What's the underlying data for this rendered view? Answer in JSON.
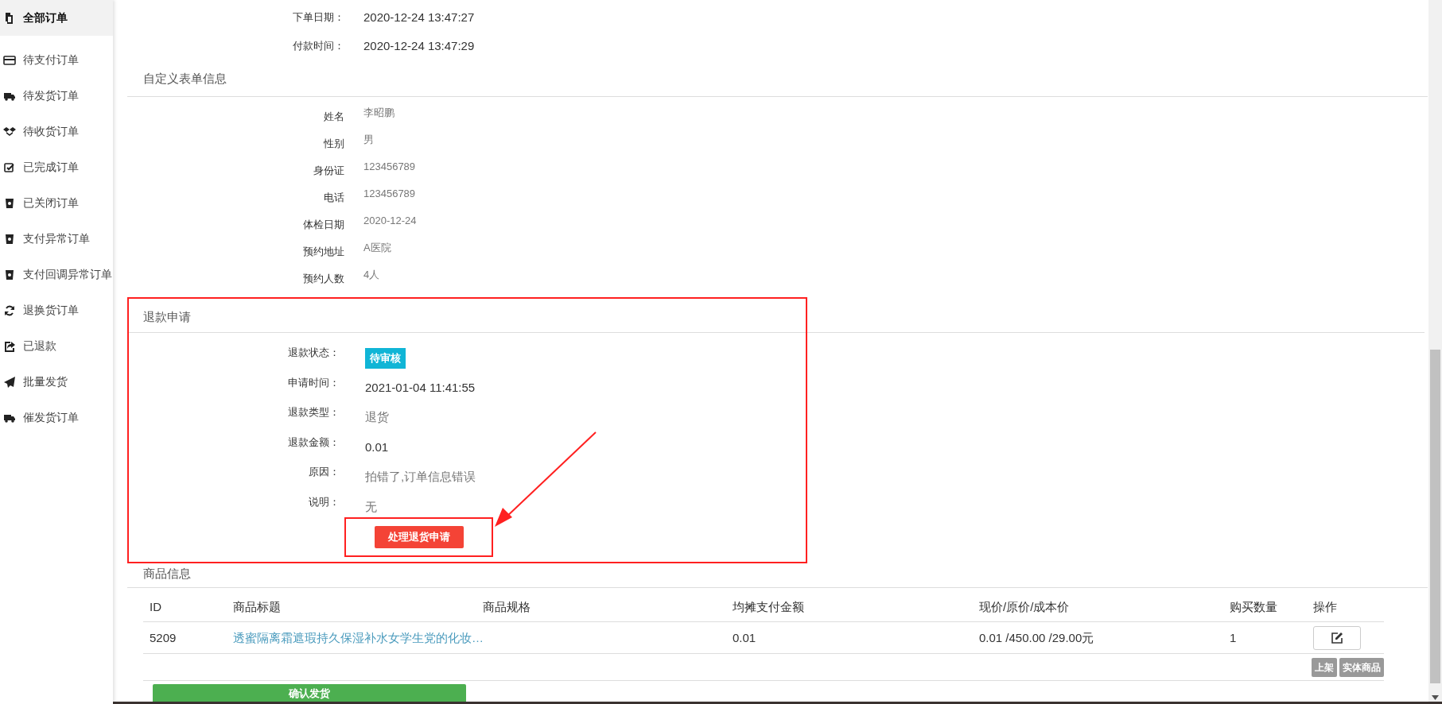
{
  "sidebar": {
    "items": [
      {
        "label": "全部订单",
        "selected": true
      },
      {
        "label": "待支付订单",
        "selected": false
      },
      {
        "label": "待发货订单",
        "selected": false
      },
      {
        "label": "待收货订单",
        "selected": false
      },
      {
        "label": "已完成订单",
        "selected": false
      },
      {
        "label": "已关闭订单",
        "selected": false
      },
      {
        "label": "支付异常订单",
        "selected": false
      },
      {
        "label": "支付回调异常订单",
        "selected": false
      },
      {
        "label": "退换货订单",
        "selected": false
      },
      {
        "label": "已退款",
        "selected": false
      },
      {
        "label": "批量发货",
        "selected": false
      },
      {
        "label": "催发货订单",
        "selected": false
      }
    ]
  },
  "order_info": [
    {
      "label": "下单日期：",
      "value": "2020-12-24 13:47:27"
    },
    {
      "label": "付款时间：",
      "value": "2020-12-24 13:47:29"
    }
  ],
  "custom_form": {
    "title": "自定义表单信息",
    "fields": [
      {
        "label": "姓名",
        "value": "李昭鹏"
      },
      {
        "label": "性别",
        "value": "男"
      },
      {
        "label": "身份证",
        "value": "123456789"
      },
      {
        "label": "电话",
        "value": "123456789"
      },
      {
        "label": "体检日期",
        "value": "2020-12-24"
      },
      {
        "label": "预约地址",
        "value": "A医院"
      },
      {
        "label": "预约人数",
        "value": "4人"
      }
    ]
  },
  "refund": {
    "title": "退款申请",
    "fields": [
      {
        "label": "退款状态：",
        "value": "待审核",
        "kind": "badge"
      },
      {
        "label": "申请时间：",
        "value": "2021-01-04 11:41:55",
        "kind": "text"
      },
      {
        "label": "退款类型：",
        "value": "退货",
        "kind": "muted"
      },
      {
        "label": "退款金额：",
        "value": "0.01",
        "kind": "text"
      },
      {
        "label": "原因：",
        "value": "拍错了,订单信息错误",
        "kind": "muted"
      },
      {
        "label": "说明：",
        "value": "无",
        "kind": "muted"
      }
    ],
    "button": "处理退货申请"
  },
  "goods": {
    "title": "商品信息",
    "columns": [
      "ID",
      "商品标题",
      "商品规格",
      "均摊支付金额",
      "现价/原价/成本价",
      "购买数量",
      "操作"
    ],
    "rows": [
      {
        "id": "5209",
        "title": "透蜜隔离霜遮瑕持久保湿补水女学生党的化妆…",
        "price": "0.01",
        "prices": "0.01 /450.00 /29.00元",
        "quantity": "1",
        "tags": [
          "上架",
          "实体商品"
        ]
      }
    ]
  },
  "confirm_button": "确认发货"
}
